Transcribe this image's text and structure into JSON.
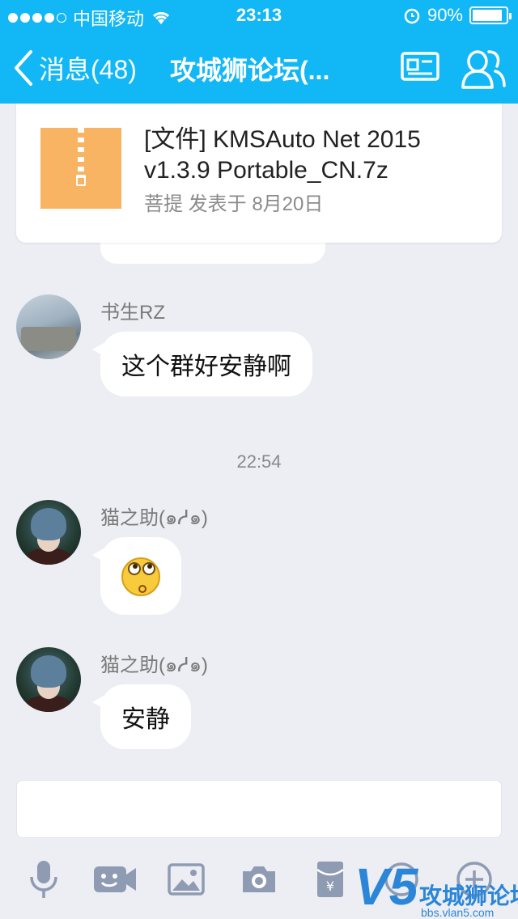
{
  "status_bar": {
    "carrier": "中国移动",
    "time": "23:13",
    "battery_percent": "90%",
    "battery_level": 0.9
  },
  "nav": {
    "back_label": "消息(48)",
    "title": "攻城狮论坛(...",
    "icons": [
      "group-card-icon",
      "group-members-icon"
    ]
  },
  "messages": {
    "file": {
      "name": "[文件] KMSAuto Net 2015 v1.3.9 Portable_CN.7z",
      "meta": "菩提 发表于 8月20日",
      "icon": "zip-file-icon"
    },
    "msg1": {
      "sender": "书生RZ",
      "text": "这个群好安静啊"
    },
    "timestamp": "22:54",
    "msg2": {
      "sender": "猫之助(๑ᓱ๑)",
      "emoji": "surprised-face-emoji"
    },
    "msg3": {
      "sender": "猫之助(๑ᓱ๑)",
      "text": "安静"
    }
  },
  "input": {
    "value": ""
  },
  "toolbar": {
    "items": [
      "microphone-icon",
      "video-call-icon",
      "image-icon",
      "camera-icon",
      "red-packet-icon",
      "emoji-icon",
      "plus-icon"
    ]
  },
  "watermark": {
    "logo_text": "V5",
    "title": "攻城狮论坛",
    "url": "bbs.vlan5.com"
  },
  "colors": {
    "header": "#12b7f5",
    "background": "#eceef3",
    "bubble": "#ffffff",
    "toolbar_icon": "#8e9bb3",
    "watermark": "#2b86d8"
  }
}
